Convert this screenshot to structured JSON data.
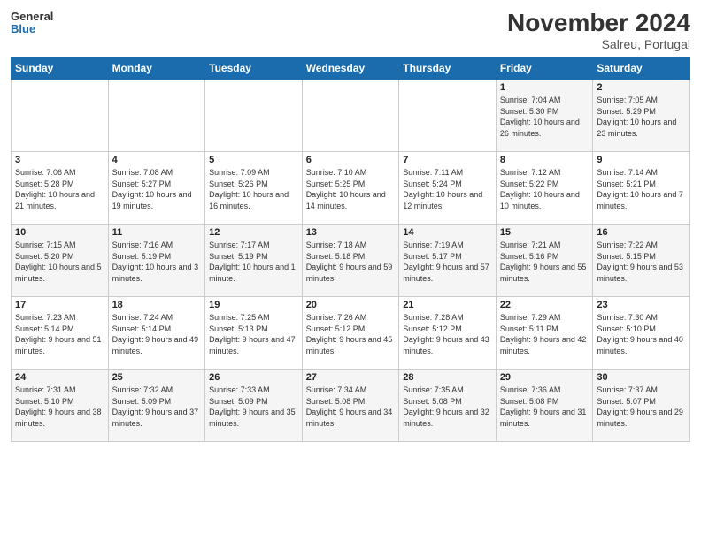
{
  "header": {
    "logo_line1": "General",
    "logo_line2": "Blue",
    "month_title": "November 2024",
    "location": "Salreu, Portugal"
  },
  "weekdays": [
    "Sunday",
    "Monday",
    "Tuesday",
    "Wednesday",
    "Thursday",
    "Friday",
    "Saturday"
  ],
  "weeks": [
    [
      {
        "day": "",
        "info": ""
      },
      {
        "day": "",
        "info": ""
      },
      {
        "day": "",
        "info": ""
      },
      {
        "day": "",
        "info": ""
      },
      {
        "day": "",
        "info": ""
      },
      {
        "day": "1",
        "info": "Sunrise: 7:04 AM\nSunset: 5:30 PM\nDaylight: 10 hours and 26 minutes."
      },
      {
        "day": "2",
        "info": "Sunrise: 7:05 AM\nSunset: 5:29 PM\nDaylight: 10 hours and 23 minutes."
      }
    ],
    [
      {
        "day": "3",
        "info": "Sunrise: 7:06 AM\nSunset: 5:28 PM\nDaylight: 10 hours and 21 minutes."
      },
      {
        "day": "4",
        "info": "Sunrise: 7:08 AM\nSunset: 5:27 PM\nDaylight: 10 hours and 19 minutes."
      },
      {
        "day": "5",
        "info": "Sunrise: 7:09 AM\nSunset: 5:26 PM\nDaylight: 10 hours and 16 minutes."
      },
      {
        "day": "6",
        "info": "Sunrise: 7:10 AM\nSunset: 5:25 PM\nDaylight: 10 hours and 14 minutes."
      },
      {
        "day": "7",
        "info": "Sunrise: 7:11 AM\nSunset: 5:24 PM\nDaylight: 10 hours and 12 minutes."
      },
      {
        "day": "8",
        "info": "Sunrise: 7:12 AM\nSunset: 5:22 PM\nDaylight: 10 hours and 10 minutes."
      },
      {
        "day": "9",
        "info": "Sunrise: 7:14 AM\nSunset: 5:21 PM\nDaylight: 10 hours and 7 minutes."
      }
    ],
    [
      {
        "day": "10",
        "info": "Sunrise: 7:15 AM\nSunset: 5:20 PM\nDaylight: 10 hours and 5 minutes."
      },
      {
        "day": "11",
        "info": "Sunrise: 7:16 AM\nSunset: 5:19 PM\nDaylight: 10 hours and 3 minutes."
      },
      {
        "day": "12",
        "info": "Sunrise: 7:17 AM\nSunset: 5:19 PM\nDaylight: 10 hours and 1 minute."
      },
      {
        "day": "13",
        "info": "Sunrise: 7:18 AM\nSunset: 5:18 PM\nDaylight: 9 hours and 59 minutes."
      },
      {
        "day": "14",
        "info": "Sunrise: 7:19 AM\nSunset: 5:17 PM\nDaylight: 9 hours and 57 minutes."
      },
      {
        "day": "15",
        "info": "Sunrise: 7:21 AM\nSunset: 5:16 PM\nDaylight: 9 hours and 55 minutes."
      },
      {
        "day": "16",
        "info": "Sunrise: 7:22 AM\nSunset: 5:15 PM\nDaylight: 9 hours and 53 minutes."
      }
    ],
    [
      {
        "day": "17",
        "info": "Sunrise: 7:23 AM\nSunset: 5:14 PM\nDaylight: 9 hours and 51 minutes."
      },
      {
        "day": "18",
        "info": "Sunrise: 7:24 AM\nSunset: 5:14 PM\nDaylight: 9 hours and 49 minutes."
      },
      {
        "day": "19",
        "info": "Sunrise: 7:25 AM\nSunset: 5:13 PM\nDaylight: 9 hours and 47 minutes."
      },
      {
        "day": "20",
        "info": "Sunrise: 7:26 AM\nSunset: 5:12 PM\nDaylight: 9 hours and 45 minutes."
      },
      {
        "day": "21",
        "info": "Sunrise: 7:28 AM\nSunset: 5:12 PM\nDaylight: 9 hours and 43 minutes."
      },
      {
        "day": "22",
        "info": "Sunrise: 7:29 AM\nSunset: 5:11 PM\nDaylight: 9 hours and 42 minutes."
      },
      {
        "day": "23",
        "info": "Sunrise: 7:30 AM\nSunset: 5:10 PM\nDaylight: 9 hours and 40 minutes."
      }
    ],
    [
      {
        "day": "24",
        "info": "Sunrise: 7:31 AM\nSunset: 5:10 PM\nDaylight: 9 hours and 38 minutes."
      },
      {
        "day": "25",
        "info": "Sunrise: 7:32 AM\nSunset: 5:09 PM\nDaylight: 9 hours and 37 minutes."
      },
      {
        "day": "26",
        "info": "Sunrise: 7:33 AM\nSunset: 5:09 PM\nDaylight: 9 hours and 35 minutes."
      },
      {
        "day": "27",
        "info": "Sunrise: 7:34 AM\nSunset: 5:08 PM\nDaylight: 9 hours and 34 minutes."
      },
      {
        "day": "28",
        "info": "Sunrise: 7:35 AM\nSunset: 5:08 PM\nDaylight: 9 hours and 32 minutes."
      },
      {
        "day": "29",
        "info": "Sunrise: 7:36 AM\nSunset: 5:08 PM\nDaylight: 9 hours and 31 minutes."
      },
      {
        "day": "30",
        "info": "Sunrise: 7:37 AM\nSunset: 5:07 PM\nDaylight: 9 hours and 29 minutes."
      }
    ]
  ]
}
